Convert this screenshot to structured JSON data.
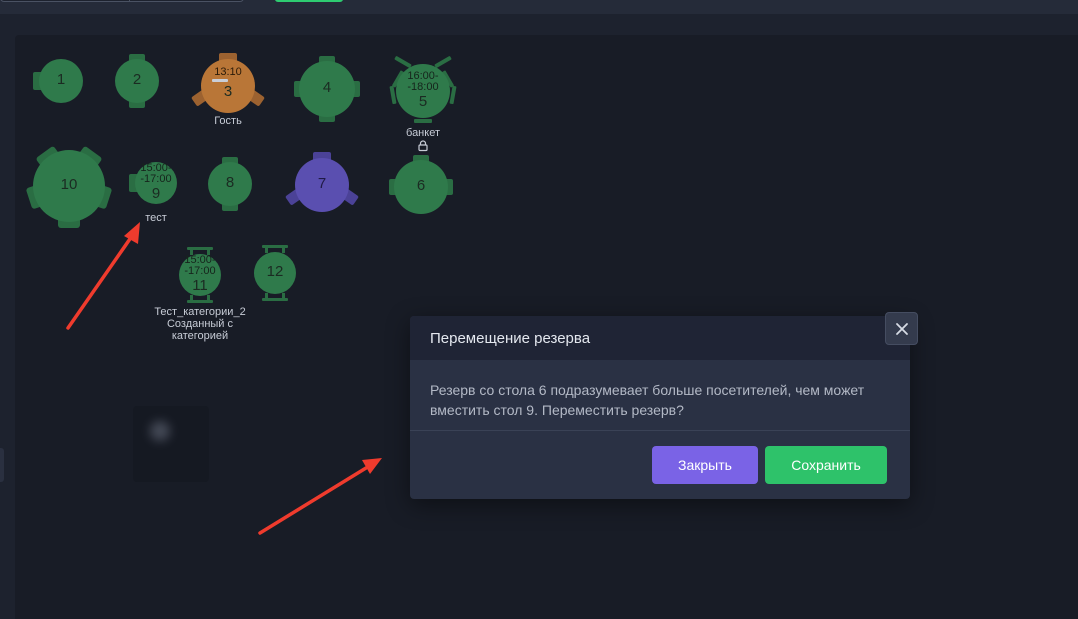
{
  "colors": {
    "table_free": "#2f7a4b",
    "table_free_seat": "#2a6d43",
    "table_occupied": "#b97637",
    "table_occupied_seat": "#9c6230",
    "table_reserved": "#5a4fb0",
    "table_reserved_seat": "#4b4297",
    "accent_purple": "#7a63e6",
    "accent_green": "#2ec26a",
    "arrow_red": "#ef3b2d"
  },
  "tables": [
    {
      "number": "1"
    },
    {
      "number": "2"
    },
    {
      "number": "3",
      "time": "13:10",
      "caption": "Гость"
    },
    {
      "number": "4"
    },
    {
      "number": "5",
      "time": "16:00-\n-18:00",
      "caption": "банкет"
    },
    {
      "number": "6"
    },
    {
      "number": "7"
    },
    {
      "number": "8"
    },
    {
      "number": "9",
      "time": "15:00-\n-17:00",
      "caption": "тест"
    },
    {
      "number": "10"
    },
    {
      "number": "11",
      "time": "15:00-\n-17:00",
      "caption": "Тест_категории_2\nСозданный с\nкатегорией"
    },
    {
      "number": "12"
    }
  ],
  "dialog": {
    "title": "Перемещение резерва",
    "message": "Резерв со стола 6 подразумевает больше посетителей, чем может вместить стол 9. Переместить резерв?",
    "close_label": "Закрыть",
    "save_label": "Сохранить",
    "close_icon": "close-icon"
  }
}
